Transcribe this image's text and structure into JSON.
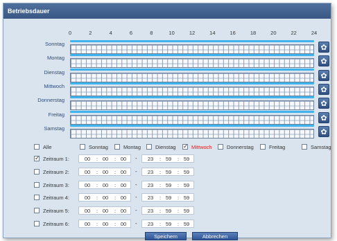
{
  "dialog": {
    "title": "Betriebsdauer"
  },
  "hour_ticks": [
    "0",
    "2",
    "4",
    "6",
    "8",
    "10",
    "12",
    "14",
    "16",
    "18",
    "20",
    "22",
    "24"
  ],
  "days": [
    "Sonntag",
    "Montag",
    "Dienstag",
    "Mittwoch",
    "Donnerstag",
    "Freitag",
    "Samstag"
  ],
  "day_checks": {
    "all_label": "Alle",
    "items": [
      {
        "label": "Sonntag",
        "checked": false,
        "highlight": false
      },
      {
        "label": "Montag",
        "checked": false,
        "highlight": false
      },
      {
        "label": "Dienstag",
        "checked": false,
        "highlight": false
      },
      {
        "label": "Mittwoch",
        "checked": true,
        "highlight": true
      },
      {
        "label": "Donnerstag",
        "checked": false,
        "highlight": false
      },
      {
        "label": "Freitag",
        "checked": false,
        "highlight": false
      },
      {
        "label": "Samstag",
        "checked": false,
        "highlight": false
      }
    ]
  },
  "periods": [
    {
      "label": "Zeitraum 1:",
      "checked": true,
      "start": [
        "00",
        "00",
        "00"
      ],
      "end": [
        "23",
        "59",
        "59"
      ]
    },
    {
      "label": "Zeitraum 2:",
      "checked": false,
      "start": [
        "00",
        "00",
        "00"
      ],
      "end": [
        "23",
        "59",
        "59"
      ]
    },
    {
      "label": "Zeitraum 3:",
      "checked": false,
      "start": [
        "00",
        "00",
        "00"
      ],
      "end": [
        "23",
        "59",
        "59"
      ]
    },
    {
      "label": "Zeitraum 4:",
      "checked": false,
      "start": [
        "00",
        "00",
        "00"
      ],
      "end": [
        "23",
        "59",
        "59"
      ]
    },
    {
      "label": "Zeitraum 5:",
      "checked": false,
      "start": [
        "00",
        "00",
        "00"
      ],
      "end": [
        "23",
        "59",
        "59"
      ]
    },
    {
      "label": "Zeitraum 6:",
      "checked": false,
      "start": [
        "00",
        "00",
        "00"
      ],
      "end": [
        "23",
        "59",
        "59"
      ]
    }
  ],
  "buttons": {
    "save": "Speichern",
    "cancel": "Abbrechen"
  },
  "colors": {
    "track": "#3fb3ee",
    "highlight": "#e02020",
    "titlebar": "#3a5785"
  }
}
